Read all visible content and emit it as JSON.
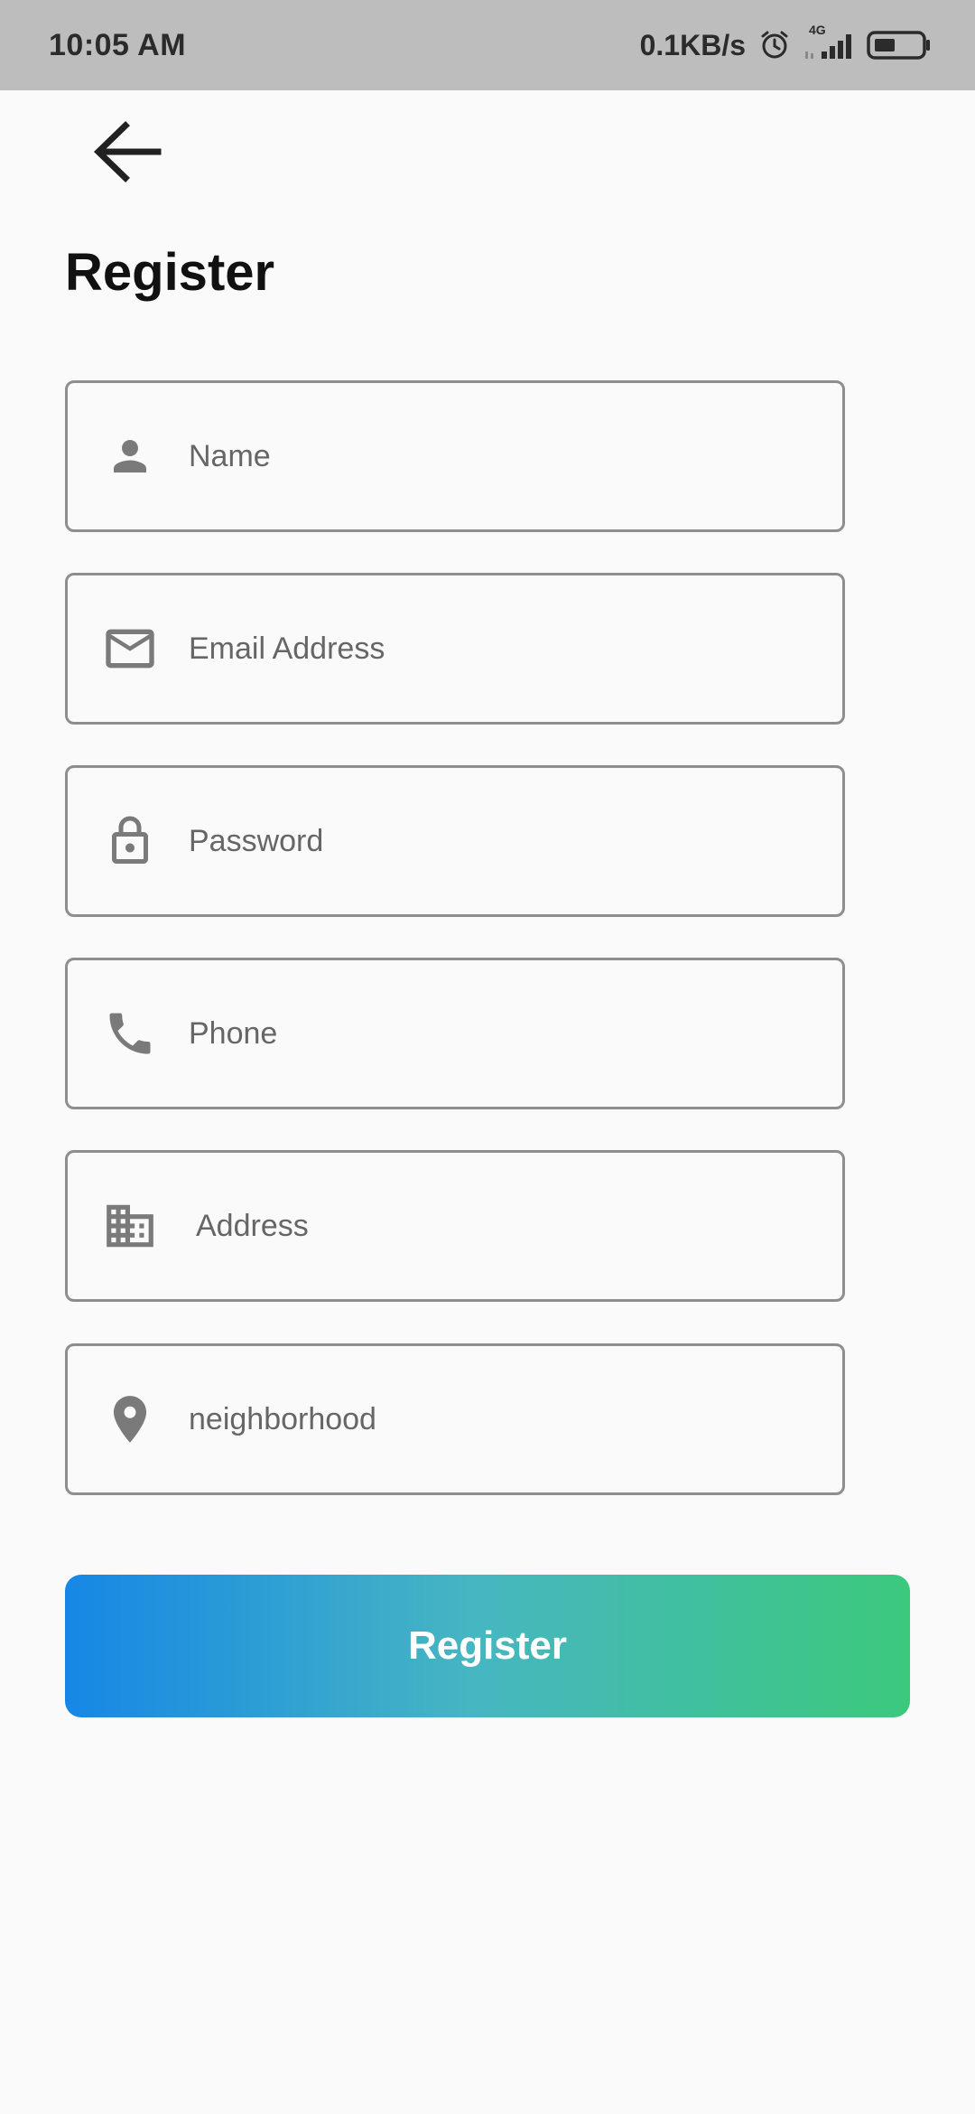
{
  "status_bar": {
    "time": "10:05 AM",
    "speed": "0.1KB/s",
    "network": "4G",
    "icons": [
      "alarm-icon",
      "signal-icon",
      "battery-icon"
    ]
  },
  "header": {
    "back_icon": "arrow-left-icon",
    "title": "Register"
  },
  "form": {
    "fields": [
      {
        "icon": "person-icon",
        "placeholder": "Name"
      },
      {
        "icon": "mail-icon",
        "placeholder": "Email Address"
      },
      {
        "icon": "lock-icon",
        "placeholder": "Password"
      },
      {
        "icon": "phone-icon",
        "placeholder": "Phone"
      },
      {
        "icon": "building-icon",
        "placeholder": "Address"
      },
      {
        "icon": "location-pin-icon",
        "placeholder": "neighborhood"
      }
    ],
    "submit_label": "Register"
  },
  "colors": {
    "status_bar": "#bdbdbd",
    "background": "#fafafa",
    "field_border": "#8e8e8e",
    "icon": "#7a7a7a",
    "gradient_start": "#1687e6",
    "gradient_mid": "#46b6c2",
    "gradient_end": "#3cc97c"
  }
}
